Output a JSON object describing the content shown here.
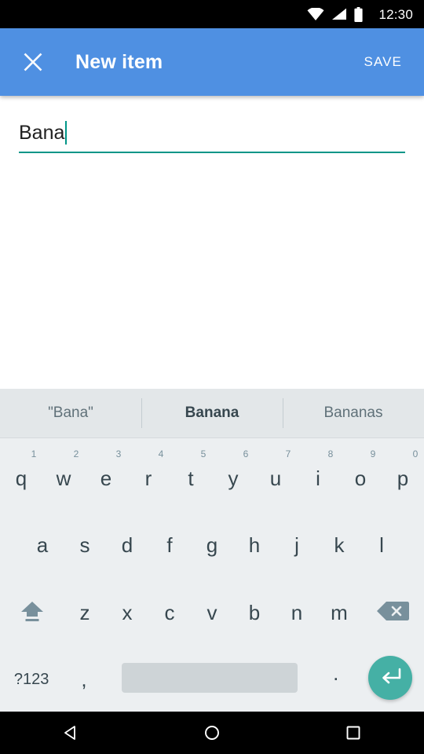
{
  "status_bar": {
    "time": "12:30",
    "icons": [
      "wifi-icon",
      "cellular-signal-icon",
      "battery-icon"
    ]
  },
  "app_bar": {
    "close_icon": "close-icon",
    "title": "New item",
    "save_label": "SAVE",
    "background_color": "#4f90e2",
    "text_color": "#ffffff"
  },
  "form": {
    "item_name_value": "Bana",
    "item_name_placeholder": "",
    "accent_color": "#009688"
  },
  "suggestions": [
    {
      "label": "\"Bana\"",
      "bold": false
    },
    {
      "label": "Banana",
      "bold": true
    },
    {
      "label": "Bananas",
      "bold": false
    }
  ],
  "keyboard": {
    "background_color": "#eceff1",
    "key_text_color": "#37474f",
    "enter_key_color": "#45b0a5",
    "row1": [
      {
        "key": "q",
        "hint": "1"
      },
      {
        "key": "w",
        "hint": "2"
      },
      {
        "key": "e",
        "hint": "3"
      },
      {
        "key": "r",
        "hint": "4"
      },
      {
        "key": "t",
        "hint": "5"
      },
      {
        "key": "y",
        "hint": "6"
      },
      {
        "key": "u",
        "hint": "7"
      },
      {
        "key": "i",
        "hint": "8"
      },
      {
        "key": "o",
        "hint": "9"
      },
      {
        "key": "p",
        "hint": "0"
      }
    ],
    "row2": [
      {
        "key": "a"
      },
      {
        "key": "s"
      },
      {
        "key": "d"
      },
      {
        "key": "f"
      },
      {
        "key": "g"
      },
      {
        "key": "h"
      },
      {
        "key": "j"
      },
      {
        "key": "k"
      },
      {
        "key": "l"
      }
    ],
    "row3": [
      {
        "key": "z"
      },
      {
        "key": "x"
      },
      {
        "key": "c"
      },
      {
        "key": "v"
      },
      {
        "key": "b"
      },
      {
        "key": "n"
      },
      {
        "key": "m"
      }
    ],
    "shift_icon": "shift-icon",
    "backspace_icon": "backspace-icon",
    "symbols_label": "?123",
    "comma_label": ",",
    "space_label": "",
    "period_label": ".",
    "enter_icon": "enter-icon"
  },
  "nav_bar": {
    "back_icon": "back-triangle-icon",
    "home_icon": "home-circle-icon",
    "recents_icon": "recents-square-icon"
  }
}
